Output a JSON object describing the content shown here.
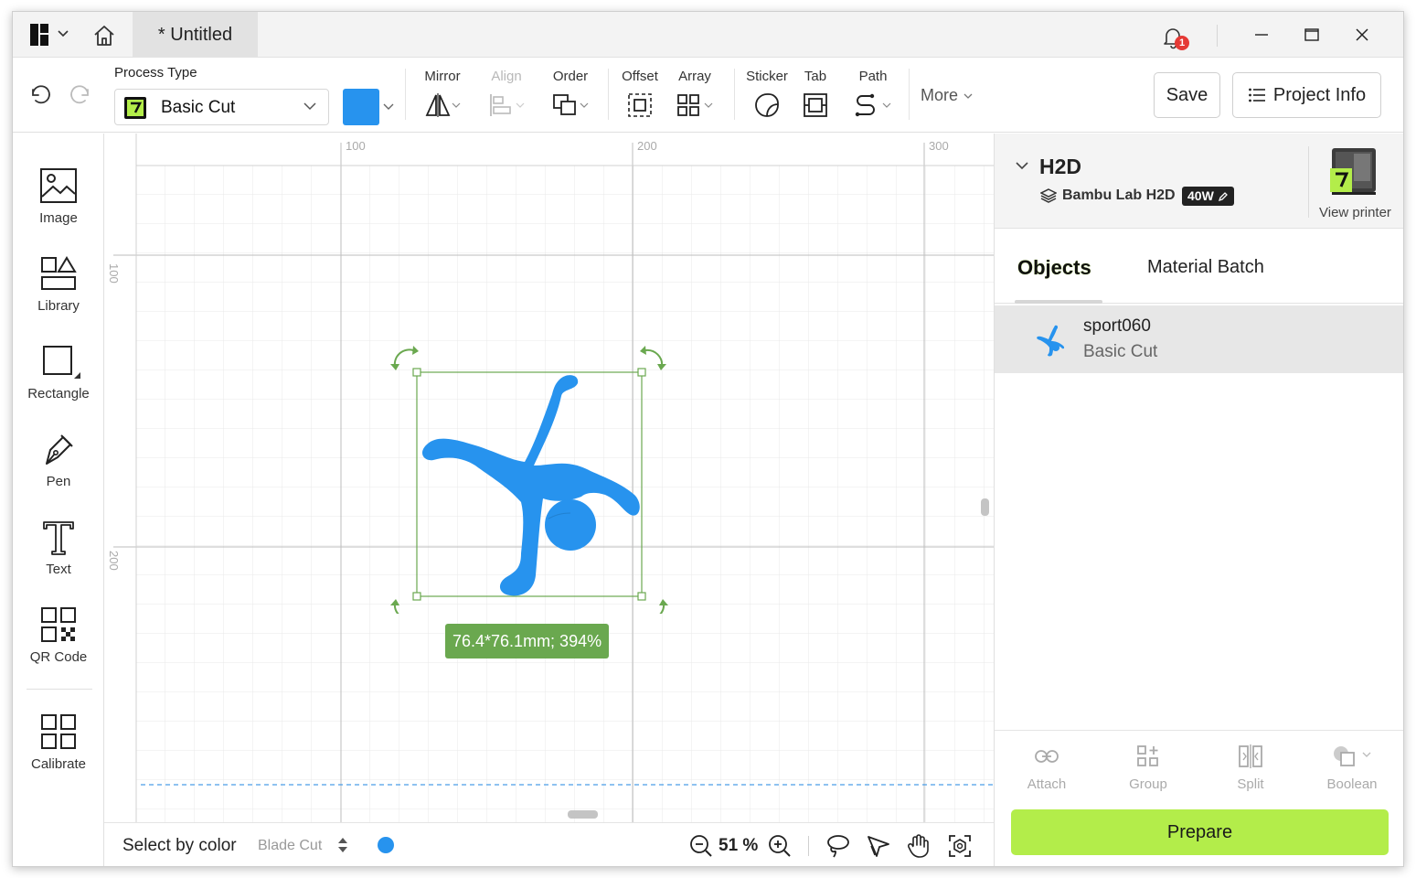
{
  "titlebar": {
    "tab_title": "* Untitled",
    "notification_count": "1"
  },
  "toolbar": {
    "process_type_label": "Process Type",
    "process_type_value": "Basic Cut",
    "color": "#2793ee",
    "tools": {
      "mirror": "Mirror",
      "align": "Align",
      "order": "Order",
      "offset": "Offset",
      "array": "Array",
      "sticker": "Sticker",
      "tab": "Tab",
      "path": "Path"
    },
    "more_label": "More",
    "save_label": "Save",
    "project_info_label": "Project Info"
  },
  "sidebar": {
    "items": [
      {
        "label": "Image",
        "icon": "image-icon"
      },
      {
        "label": "Library",
        "icon": "library-icon"
      },
      {
        "label": "Rectangle",
        "icon": "rectangle-icon"
      },
      {
        "label": "Pen",
        "icon": "pen-icon"
      },
      {
        "label": "Text",
        "icon": "text-icon"
      },
      {
        "label": "QR Code",
        "icon": "qr-code-icon"
      },
      {
        "label": "Calibrate",
        "icon": "calibrate-icon"
      }
    ]
  },
  "canvas": {
    "ruler_top": [
      "100",
      "200",
      "300"
    ],
    "ruler_left": [
      "100",
      "200"
    ],
    "selection_info": "76.4*76.1mm; 394%",
    "select_by_color_label": "Select by color",
    "blade_label": "Blade Cut",
    "zoom_value": "51 %",
    "accent_color": "#2793ee",
    "selection_color": "#6aa84f"
  },
  "right_panel": {
    "printer_name": "H2D",
    "printer_model": "Bambu Lab H2D",
    "laser_power": "40W",
    "view_printer_label": "View printer",
    "tabs": [
      "Objects",
      "Material Batch"
    ],
    "objects": [
      {
        "name": "sport060",
        "type": "Basic Cut"
      }
    ],
    "actions": [
      "Attach",
      "Group",
      "Split",
      "Boolean"
    ],
    "prepare_label": "Prepare",
    "prepare_color": "#b3ed4a"
  }
}
